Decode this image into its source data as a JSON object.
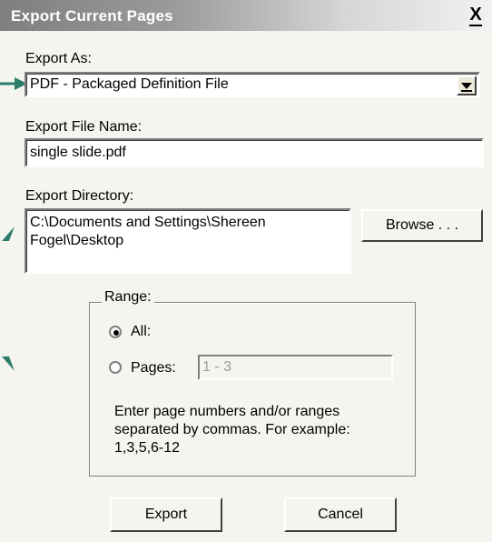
{
  "window": {
    "title": "Export Current Pages",
    "close_glyph": "X"
  },
  "export_as": {
    "label": "Export As:",
    "value": "PDF - Packaged Definition File"
  },
  "file_name": {
    "label": "Export File Name:",
    "value": "single slide.pdf"
  },
  "directory": {
    "label": "Export Directory:",
    "line1": "C:\\Documents and Settings\\Shereen",
    "line2": "Fogel\\Desktop",
    "browse_label": "Browse . . ."
  },
  "range": {
    "title": "Range:",
    "all_label": "All:",
    "pages_label": "Pages:",
    "pages_value": "1 - 3",
    "hint_line1": "Enter page numbers and/or ranges",
    "hint_line2": "separated by commas.  For example:",
    "hint_line3": "1,3,5,6-12"
  },
  "actions": {
    "export_label": "Export",
    "cancel_label": "Cancel"
  },
  "colors": {
    "arrow": "#2e7d6b",
    "title_text": "#ffffff"
  }
}
